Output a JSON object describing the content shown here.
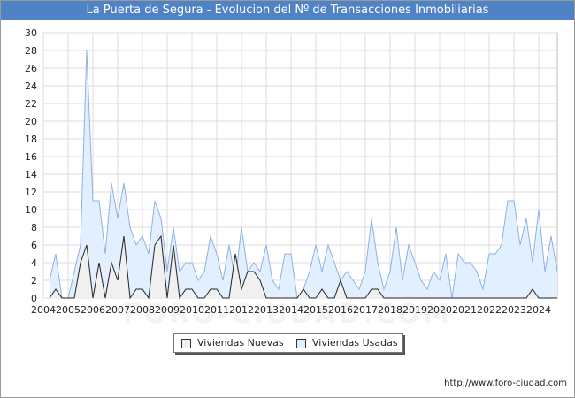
{
  "header": {
    "title": "La Puerta de Segura - Evolucion del Nº de Transacciones Inmobiliarias"
  },
  "footer": {
    "url": "http://www.foro-ciudad.com"
  },
  "watermark": {
    "text": "FORO-CIUDAD.COM"
  },
  "colors": {
    "nuevas_fill": "#f0f0f0",
    "nuevas_line": "#222222",
    "usadas_fill": "#e2efff",
    "usadas_line": "#8fb1e3",
    "grid": "#dcdcdc",
    "title_bg": "#4f83c6"
  },
  "chart_data": {
    "type": "area",
    "title": "La Puerta de Segura - Evolucion del Nº de Transacciones Inmobiliarias",
    "xlabel": "",
    "ylabel": "",
    "ylim": [
      0,
      30
    ],
    "yticks": [
      0,
      2,
      4,
      6,
      8,
      10,
      12,
      14,
      16,
      18,
      20,
      22,
      24,
      26,
      28,
      30
    ],
    "xlim": [
      2004,
      2024.75
    ],
    "xticks": [
      "2004",
      "2005",
      "2006",
      "2007",
      "2008",
      "2009",
      "2010",
      "2011",
      "2012",
      "2013",
      "2014",
      "2015",
      "2016",
      "2017",
      "2018",
      "2019",
      "2020",
      "2021",
      "2022",
      "2023",
      "2024"
    ],
    "x_start": 2004.25,
    "x_step": 0.25,
    "grid": true,
    "legend_position": "bottom",
    "series": [
      {
        "name": "Viviendas Usadas",
        "values": [
          2,
          5,
          0,
          0,
          3,
          6,
          28,
          11,
          11,
          5,
          13,
          9,
          13,
          8,
          6,
          7,
          5,
          11,
          9,
          3,
          8,
          3,
          4,
          4,
          2,
          3,
          7,
          5,
          2,
          6,
          2,
          8,
          3,
          4,
          3,
          6,
          2,
          1,
          5,
          5,
          0,
          1,
          3,
          6,
          3,
          6,
          4,
          2,
          3,
          2,
          1,
          3,
          9,
          4,
          1,
          3,
          8,
          2,
          6,
          4,
          2,
          1,
          3,
          2,
          5,
          0,
          5,
          4,
          4,
          3,
          1,
          5,
          5,
          6,
          11,
          11,
          6,
          9,
          4,
          10,
          3,
          7,
          3
        ]
      },
      {
        "name": "Viviendas Nuevas",
        "values": [
          0,
          1,
          0,
          0,
          0,
          4,
          6,
          0,
          4,
          0,
          4,
          2,
          7,
          0,
          1,
          1,
          0,
          6,
          7,
          0,
          6,
          0,
          1,
          1,
          0,
          0,
          1,
          1,
          0,
          0,
          5,
          1,
          3,
          3,
          2,
          0,
          0,
          0,
          0,
          0,
          0,
          1,
          0,
          0,
          1,
          0,
          0,
          2,
          0,
          0,
          0,
          0,
          1,
          1,
          0,
          0,
          0,
          0,
          0,
          0,
          0,
          0,
          0,
          0,
          0,
          0,
          0,
          0,
          0,
          0,
          0,
          0,
          0,
          0,
          0,
          0,
          0,
          0,
          1,
          0,
          0,
          0,
          0
        ]
      }
    ]
  }
}
